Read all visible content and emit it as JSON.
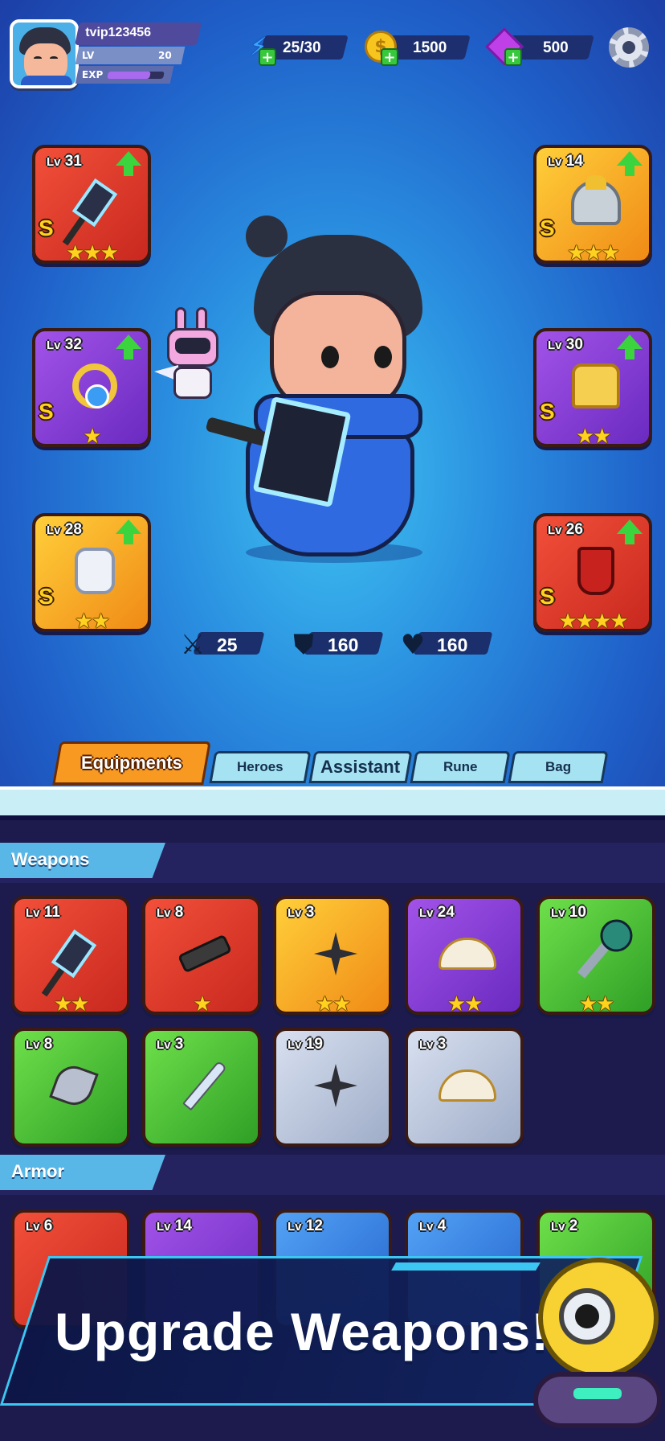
{
  "player": {
    "name": "tvip123456",
    "lv_label": "LV",
    "lv_value": "20",
    "exp_label": "EXP",
    "exp_progress": 0.75
  },
  "resources": {
    "energy": {
      "value": "25/30",
      "icon": "lightning-icon"
    },
    "coins": {
      "value": "1500",
      "icon": "coin-icon"
    },
    "gems": {
      "value": "500",
      "icon": "gem-icon"
    }
  },
  "equipped": {
    "weapon": {
      "level": "31",
      "grade": "S",
      "stars": 3,
      "upgradable": true,
      "color": "red",
      "icon": "hammer-icon"
    },
    "helmet": {
      "level": "14",
      "grade": "S",
      "stars": 3,
      "upgradable": true,
      "color": "orange",
      "icon": "helmet-icon"
    },
    "necklace": {
      "level": "32",
      "grade": "S",
      "stars": 1,
      "upgradable": true,
      "color": "purple",
      "icon": "amulet-icon"
    },
    "armor": {
      "level": "30",
      "grade": "S",
      "stars": 2,
      "upgradable": true,
      "color": "purple",
      "icon": "armor-icon"
    },
    "gloves": {
      "level": "28",
      "grade": "S",
      "stars": 2,
      "upgradable": true,
      "color": "orange",
      "icon": "glove-icon"
    },
    "boots": {
      "level": "26",
      "grade": "S",
      "stars": 4,
      "upgradable": true,
      "color": "red",
      "icon": "boot-icon"
    }
  },
  "lv_prefix": "Lv",
  "stats": {
    "attack": "25",
    "defense": "160",
    "health": "160"
  },
  "tabs": [
    {
      "label": "Equipments",
      "active": true
    },
    {
      "label": "Heroes",
      "active": false
    },
    {
      "label": "Assistant",
      "active": false
    },
    {
      "label": "Rune",
      "active": false
    },
    {
      "label": "Bag",
      "active": false
    }
  ],
  "sections": {
    "weapons_title": "Weapons",
    "armor_title": "Armor"
  },
  "weapons": [
    {
      "level": "11",
      "stars": 2,
      "color": "red",
      "icon": "hammer-icon"
    },
    {
      "level": "8",
      "stars": 1,
      "color": "red",
      "icon": "gatling-gun-icon"
    },
    {
      "level": "3",
      "stars": 2,
      "color": "orange",
      "icon": "shuriken-icon"
    },
    {
      "level": "24",
      "stars": 2,
      "color": "purple",
      "icon": "fan-icon"
    },
    {
      "level": "10",
      "stars": 2,
      "color": "green",
      "icon": "staff-icon"
    },
    {
      "level": "8",
      "stars": 0,
      "color": "green",
      "icon": "axe-icon"
    },
    {
      "level": "3",
      "stars": 0,
      "color": "green",
      "icon": "dagger-icon"
    },
    {
      "level": "19",
      "stars": 0,
      "color": "grey",
      "icon": "shuriken-icon"
    },
    {
      "level": "3",
      "stars": 0,
      "color": "grey",
      "icon": "fan-icon"
    }
  ],
  "armors": [
    {
      "level": "6",
      "color": "red"
    },
    {
      "level": "14",
      "color": "purple"
    },
    {
      "level": "12",
      "color": "blue"
    },
    {
      "level": "4",
      "color": "blue"
    },
    {
      "level": "2",
      "color": "green"
    }
  ],
  "banner": {
    "title": "Upgrade Weapons!"
  }
}
